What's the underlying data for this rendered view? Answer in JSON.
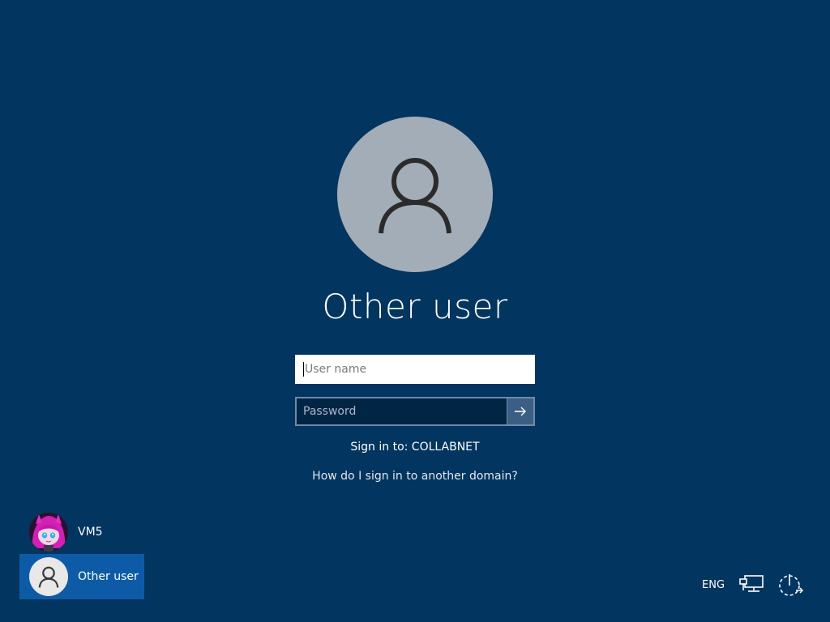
{
  "main": {
    "user_title": "Other user",
    "username_placeholder": "User name",
    "password_placeholder": "Password",
    "sign_in_to": "Sign in to: COLLABNET",
    "other_domain_link": "How do I sign in to another domain?"
  },
  "users": [
    {
      "name": "VM5",
      "avatar_icon": "anime-avatar-icon"
    },
    {
      "name": "Other user",
      "avatar_icon": "person-icon",
      "selected": true
    }
  ],
  "tray": {
    "language": "ENG",
    "network_icon": "network-icon",
    "power_icon": "power-icon"
  },
  "colors": {
    "background": "#02355f",
    "selected_user": "#0d5ba6",
    "avatar_bg": "#a3adb8"
  }
}
